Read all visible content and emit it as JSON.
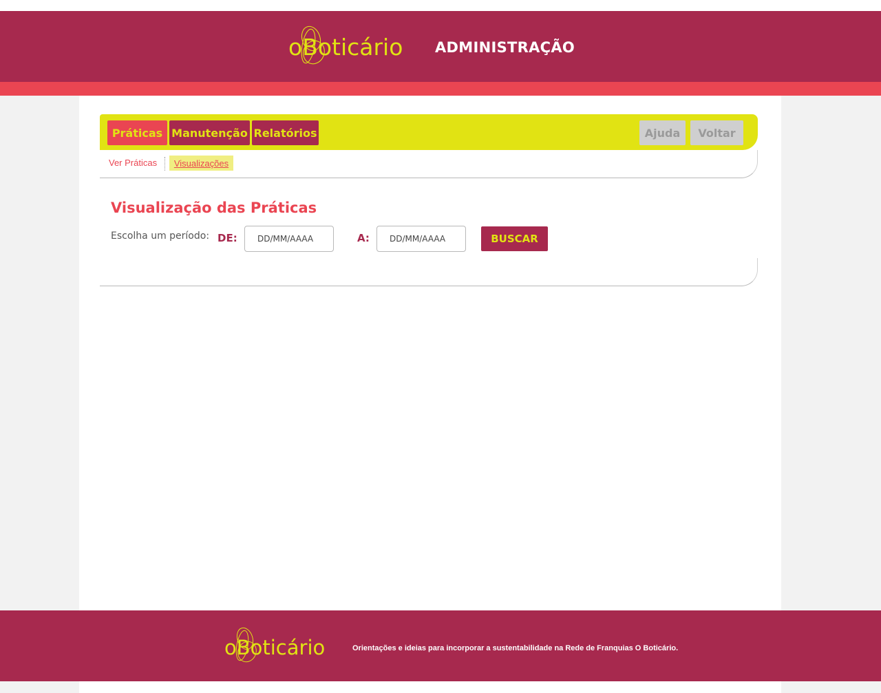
{
  "header": {
    "logo_text": "oBoticário",
    "title": "ADMINISTRAÇÃO"
  },
  "menu": {
    "items": [
      {
        "label": "Práticas",
        "state": "active"
      },
      {
        "label": "Manutenção",
        "state": "normal"
      },
      {
        "label": "Relatórios",
        "state": "normal"
      }
    ],
    "right_items": [
      {
        "label": "Ajuda",
        "state": "disabled"
      },
      {
        "label": "Voltar",
        "state": "disabled"
      }
    ]
  },
  "sub_nav": {
    "items": [
      {
        "label": "Ver Práticas"
      },
      {
        "label": "Visualizações",
        "active": true
      }
    ]
  },
  "main": {
    "title": "Visualização das Práticas",
    "period_label": "Escolha um período:",
    "from_label": "DE:",
    "from_placeholder": "DD/MM/AAAA",
    "to_label": "A:",
    "to_placeholder": "DD/MM/AAAA",
    "search_label": "BUSCAR"
  },
  "footer": {
    "logo_text": "oBoticário",
    "tagline": "Orientações e ideias para incorporar a sustentabilidade na Rede de Franquias O Boticário."
  },
  "colors": {
    "brand_wine": "#a7294e",
    "brand_coral": "#ea4552",
    "brand_yellow": "#e1e313",
    "disabled_gray": "#cfcfcf"
  }
}
